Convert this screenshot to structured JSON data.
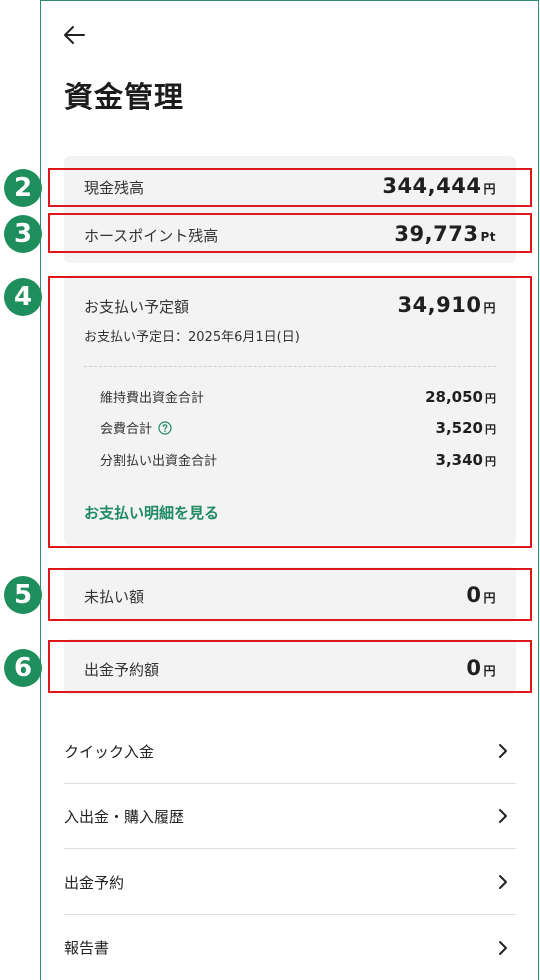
{
  "header": {
    "title": "資金管理"
  },
  "balances": {
    "cash_label": "現金残高",
    "cash_value": "344,444",
    "cash_unit": "円",
    "points_label": "ホースポイント残高",
    "points_value": "39,773",
    "points_unit": "Pt"
  },
  "payment": {
    "label": "お支払い予定額",
    "value": "34,910",
    "unit": "円",
    "due_date": "お支払い予定日：2025年6月1日(日)",
    "items": [
      {
        "label": "維持費出資金合計",
        "value": "28,050",
        "unit": "円"
      },
      {
        "label": "会費合計",
        "value": "3,520",
        "unit": "円"
      },
      {
        "label": "分割払い出資金合計",
        "value": "3,340",
        "unit": "円"
      }
    ],
    "detail_link": "お支払い明細を見る"
  },
  "unpaid": {
    "label": "未払い額",
    "value": "0",
    "unit": "円"
  },
  "withdraw_reservation": {
    "label": "出金予約額",
    "value": "0",
    "unit": "円"
  },
  "annotations": {
    "b2": "2",
    "b3": "3",
    "b4": "4",
    "b5": "5",
    "b6": "6",
    "color": "#1e8f5c",
    "box_color": "#e0161c"
  },
  "menu": [
    {
      "label": "クイック入金",
      "icon": "chevron-right-icon"
    },
    {
      "label": "入出金・購入履歴",
      "icon": "chevron-right-icon"
    },
    {
      "label": "出金予約",
      "icon": "chevron-right-icon"
    },
    {
      "label": "報告書",
      "icon": "chevron-right-icon"
    }
  ],
  "theme": {
    "accent": "#1f8a63",
    "panel_bg": "#f3f3f3"
  }
}
